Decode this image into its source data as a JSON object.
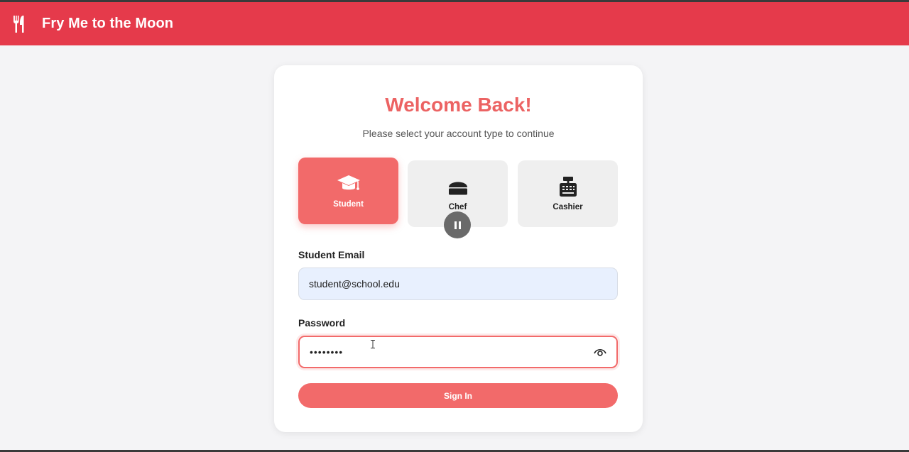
{
  "app": {
    "title": "Fry Me to the Moon",
    "brand_color": "#e53a4b",
    "nav_icon": "utensils-icon"
  },
  "login": {
    "heading": "Welcome Back!",
    "subheading": "Please select your account type to continue",
    "account_types": [
      {
        "label": "Student",
        "icon": "graduation-cap-icon",
        "selected": true
      },
      {
        "label": "Chef",
        "icon": "chef-hat-icon",
        "selected": false
      },
      {
        "label": "Cashier",
        "icon": "cash-register-icon",
        "selected": false
      }
    ],
    "email": {
      "label": "Student Email",
      "value": "student@school.edu"
    },
    "password": {
      "label": "Password",
      "value": "••••••••",
      "toggle_icon": "eye-icon"
    },
    "submit_label": "Sign In",
    "accent_color": "#f26a6a"
  },
  "overlay": {
    "icon": "pause-icon"
  }
}
